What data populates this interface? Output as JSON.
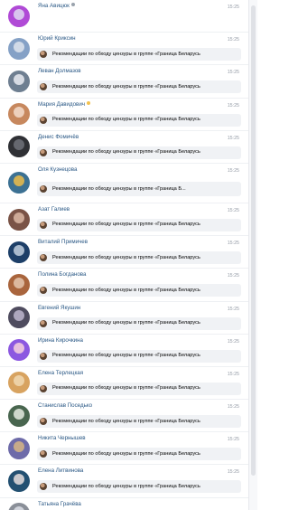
{
  "message_preview_prefix": "Рекомендации по обходу цензуры в группе «Граница Беларусь",
  "rows": [
    {
      "name": "Яна Авицюк",
      "time": "15:25",
      "preview": "",
      "name_icon": "muted-icon",
      "avatar_colors": [
        "#b04ad6",
        "#ddd1ef"
      ],
      "show_preview": false
    },
    {
      "name": "Юрий Криксин",
      "time": "15:25",
      "preview": "Рекомендации по обходу цензуры в группе «Граница Беларусь",
      "avatar_colors": [
        "#85a1c6",
        "#d9e0ea"
      ],
      "show_preview": true
    },
    {
      "name": "Леван Долмазов",
      "time": "15:25",
      "preview": "Рекомендации по обходу цензуры в группе «Граница Беларусь",
      "avatar_colors": [
        "#6f7f91",
        "#e2e6ec"
      ],
      "show_preview": true
    },
    {
      "name": "Мария Давидович",
      "time": "15:25",
      "preview": "Рекомендации по обходу цензуры в группе «Граница Беларусь",
      "name_icon": "emoji-icon",
      "avatar_colors": [
        "#c7885e",
        "#f1d8c7"
      ],
      "show_preview": true
    },
    {
      "name": "Денис Фомичёв",
      "time": "15:25",
      "preview": "Рекомендации по обходу цензуры в группе «Граница Беларусь",
      "avatar_colors": [
        "#2f3035",
        "#6b6e76"
      ],
      "show_preview": true
    },
    {
      "name": "Оля Кузнецова",
      "time": "15:25",
      "preview": "Рекомендации по обходу цензуры в группе «Граница Б...",
      "avatar_colors": [
        "#3c7193",
        "#e2b84e"
      ],
      "show_preview": true,
      "tall": true
    },
    {
      "name": "Азат Галиев",
      "time": "15:25",
      "preview": "Рекомендации по обходу цензуры в группе «Граница Беларусь",
      "avatar_colors": [
        "#7a5346",
        "#d6b39f"
      ],
      "show_preview": true
    },
    {
      "name": "Виталий Примичев",
      "time": "15:25",
      "preview": "Рекомендации по обходу цензуры в группе «Граница Беларусь",
      "avatar_colors": [
        "#1d3f68",
        "#b9c8d8"
      ],
      "show_preview": true
    },
    {
      "name": "Полина Богданова",
      "time": "15:25",
      "preview": "Рекомендации по обходу цензуры в группе «Граница Беларусь",
      "avatar_colors": [
        "#a9653d",
        "#e1c1a8"
      ],
      "show_preview": true
    },
    {
      "name": "Евгений Якушин",
      "time": "15:25",
      "preview": "Рекомендации по обходу цензуры в группе «Граница Беларусь",
      "avatar_colors": [
        "#4f4c5f",
        "#b7b0c8"
      ],
      "show_preview": true
    },
    {
      "name": "Ирина Кирочкина",
      "time": "15:25",
      "preview": "Рекомендации по обходу цензуры в группе «Граница Беларусь",
      "avatar_colors": [
        "#8c58e0",
        "#f1ccdd"
      ],
      "show_preview": true
    },
    {
      "name": "Елена Терлецкая",
      "time": "15:25",
      "preview": "Рекомендации по обходу цензуры в группе «Граница Беларусь",
      "avatar_colors": [
        "#d8a360",
        "#f0d6ae"
      ],
      "show_preview": true
    },
    {
      "name": "Станислав Поседько",
      "time": "15:25",
      "preview": "Рекомендации по обходу цензуры в группе «Граница Беларусь",
      "avatar_colors": [
        "#49664f",
        "#dbe3d8"
      ],
      "show_preview": true
    },
    {
      "name": "Никита Чернышев",
      "time": "15:25",
      "preview": "Рекомендации по обходу цензуры в группе «Граница Беларусь",
      "avatar_colors": [
        "#6e6ba9",
        "#d0b186"
      ],
      "show_preview": true
    },
    {
      "name": "Елена Литвинова",
      "time": "15:25",
      "preview": "Рекомендации по обходу цензуры в группе «Граница Беларусь",
      "avatar_colors": [
        "#235071",
        "#dcd6d7"
      ],
      "show_preview": true
    },
    {
      "name": "Татьяна Грачёва",
      "time": "",
      "preview": "",
      "avatar_colors": [
        "#8a8f98",
        "#d8dce3"
      ],
      "show_preview": false
    }
  ]
}
